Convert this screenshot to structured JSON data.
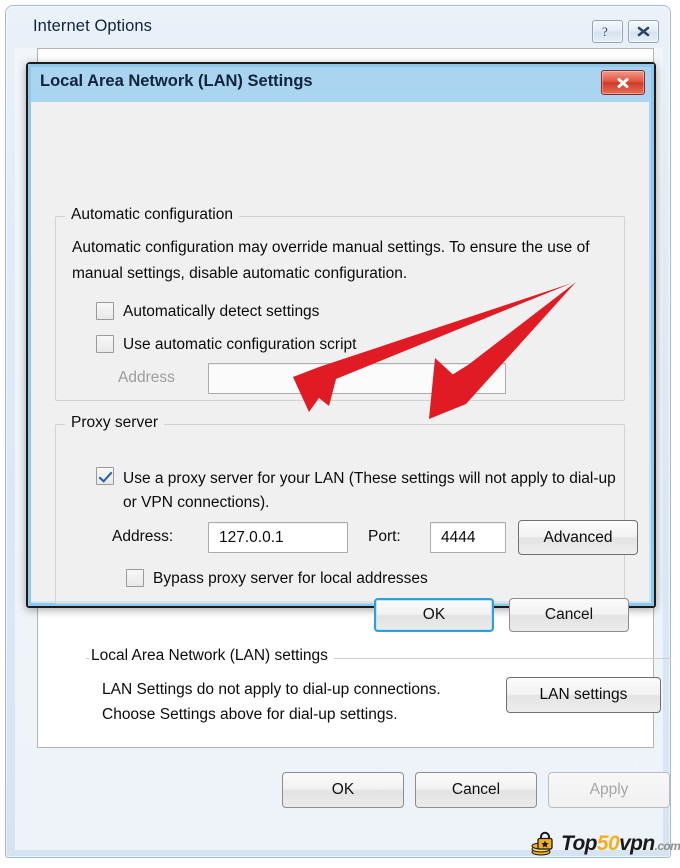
{
  "outer_window": {
    "title": "Internet Options",
    "help_button": {
      "name": "help-button",
      "glyph": "?"
    },
    "close_button": {
      "name": "close-button",
      "glyph": "✕"
    },
    "lan_group": {
      "legend": "Local Area Network (LAN) settings",
      "description": "LAN Settings do not apply to dial-up connections. Choose Settings above for dial-up settings.",
      "button_label": "LAN settings"
    },
    "footer": {
      "ok_label": "OK",
      "cancel_label": "Cancel",
      "apply_label": "Apply",
      "apply_disabled": true
    }
  },
  "modal": {
    "title": "Local Area Network (LAN) Settings",
    "close_button": {
      "name": "close-icon",
      "glyph": "✕",
      "color": "#d03a22"
    },
    "automatic_configuration": {
      "legend": "Automatic configuration",
      "description": "Automatic configuration may override manual settings.  To ensure the use of manual settings, disable automatic configuration.",
      "auto_detect": {
        "label": "Automatically detect settings",
        "checked": false
      },
      "auto_script": {
        "label": "Use automatic configuration script",
        "checked": false
      },
      "address_label": "Address",
      "address_value": "",
      "address_disabled": true
    },
    "proxy_server": {
      "legend": "Proxy server",
      "use_proxy": {
        "label": "Use a proxy server for your LAN (These settings will not apply to dial-up or VPN connections).",
        "checked": true
      },
      "address_label": "Address:",
      "address_value": "127.0.0.1",
      "port_label": "Port:",
      "port_value": "4444",
      "advanced_label": "Advanced",
      "bypass": {
        "label": "Bypass proxy server for local addresses",
        "checked": false
      }
    },
    "footer": {
      "ok_label": "OK",
      "cancel_label": "Cancel",
      "default_button": "OK"
    }
  },
  "annotations": {
    "arrow_color": "#e01b24",
    "arrows": [
      {
        "name": "arrow-to-proxy-address",
        "from": [
          572,
          284
        ],
        "to": [
          300,
          400
        ]
      },
      {
        "name": "arrow-to-proxy-port",
        "from": [
          572,
          284
        ],
        "to": [
          428,
          418
        ]
      }
    ]
  },
  "watermark": {
    "icon": "padlock-coins-icon",
    "text_top": "Top",
    "text_50": "50",
    "text_vpn": "vpn",
    "text_com": ".com"
  }
}
